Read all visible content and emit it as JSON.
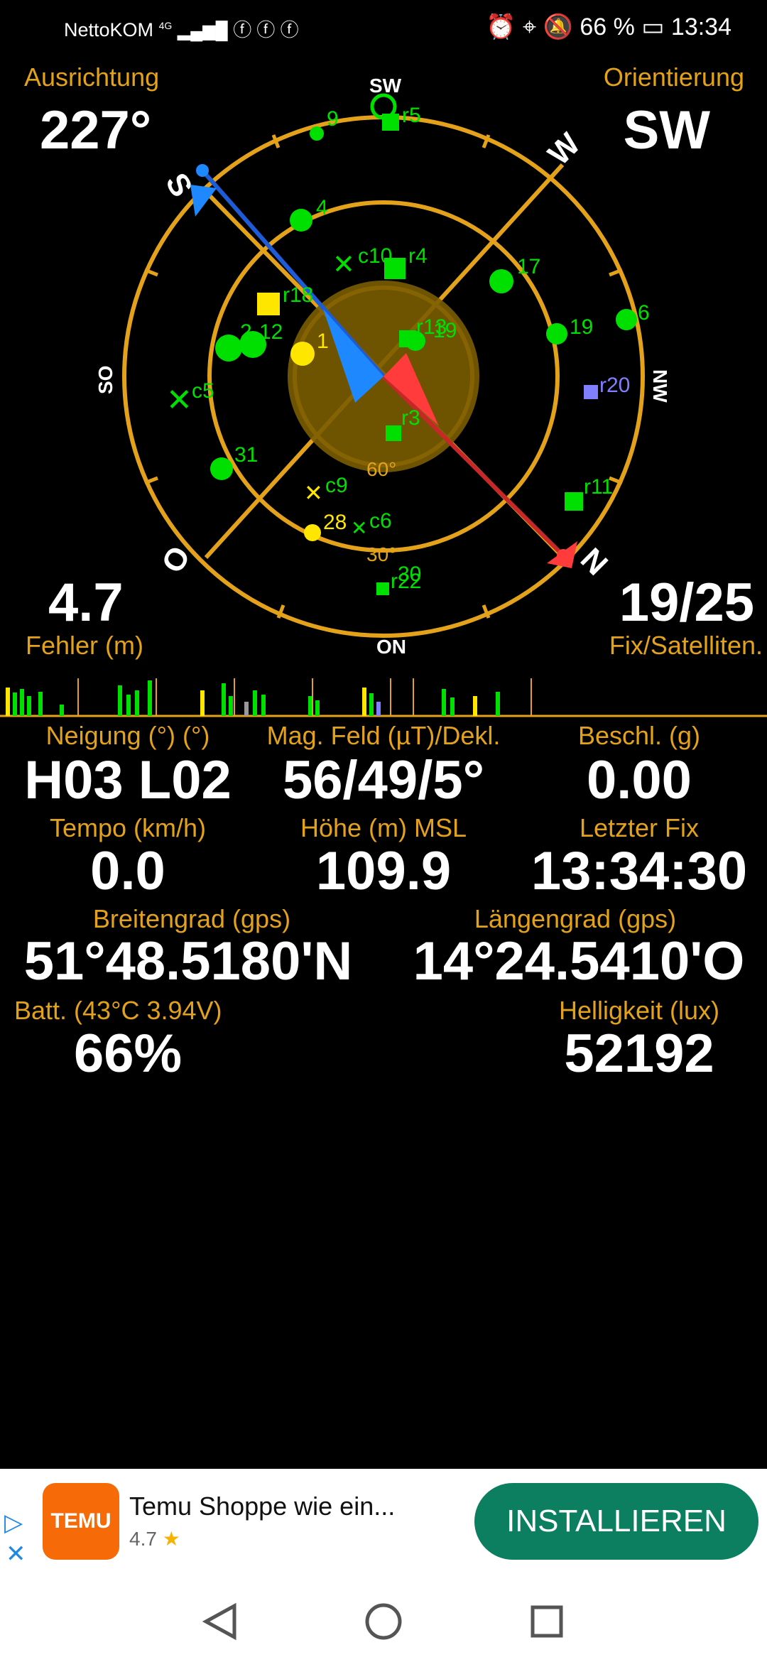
{
  "status_bar": {
    "carrier": "NettoKOM",
    "network": "4G",
    "battery_text": "66 %",
    "time": "13:34"
  },
  "compass": {
    "heading_label": "Ausrichtung",
    "heading_value": "227°",
    "orientation_label": "Orientierung",
    "orientation_value": "SW",
    "error_value": "4.7",
    "error_label": "Fehler (m)",
    "fix_value": "19/25",
    "fix_label": "Fix/Satelliten.",
    "directions": {
      "top": "SW",
      "right": "NW",
      "bottom": "ON",
      "left": "SO",
      "w": "W",
      "s": "S",
      "n": "N",
      "o": "O"
    },
    "ring_labels": [
      "60°",
      "30°"
    ],
    "satellites": [
      "9",
      "r5",
      "4",
      "c10",
      "r4",
      "r18",
      "17",
      "19",
      "6",
      "2",
      "12",
      "1",
      "r13",
      "19",
      "c5",
      "r20",
      "r3",
      "31",
      "c9",
      "28",
      "c6",
      "r11",
      "r22",
      "30"
    ]
  },
  "data": {
    "tilt_label": "Neigung (°) (°)",
    "tilt_value": "H03 L02",
    "mag_label": "Mag. Feld (µT)/Dekl.",
    "mag_value": "56/49/5°",
    "accel_label": "Beschl. (g)",
    "accel_value": "0.00",
    "speed_label": "Tempo (km/h)",
    "speed_value": "0.0",
    "alt_label": "Höhe (m) MSL",
    "alt_value": "109.9",
    "lastfix_label": "Letzter Fix",
    "lastfix_value": "13:34:30",
    "lat_label": "Breitengrad (gps)",
    "lat_value": "51°48.5180'N",
    "lon_label": "Längengrad (gps)",
    "lon_value": "14°24.5410'O",
    "batt_label": "Batt. (43°C 3.94V)",
    "batt_value": "66%",
    "lux_label": "Helligkeit (lux)",
    "lux_value": "52192"
  },
  "ad": {
    "app_name": "Temu Shoppe wie ein...",
    "rating": "4.7",
    "logo_text": "TEMU",
    "install_label": "INSTALLIEREN"
  },
  "colors": {
    "gold": "#e3a21a",
    "green": "#00e000",
    "yellow": "#ffe600",
    "blue": "#1e88ff",
    "red": "#ff3b3b",
    "ad_button": "#0b7f60"
  }
}
